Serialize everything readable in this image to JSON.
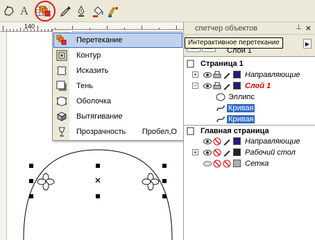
{
  "toolbar": {
    "tools": [
      {
        "name": "shape-tool",
        "icon": "shape-icon"
      },
      {
        "name": "text-tool",
        "icon": "text-icon",
        "glyph": "A"
      },
      {
        "name": "table-tool",
        "icon": "table-icon"
      },
      {
        "name": "interactive-blend-tool",
        "icon": "blend-icon"
      },
      {
        "name": "eyedropper-tool",
        "icon": "eyedropper-icon"
      },
      {
        "name": "outline-tool",
        "icon": "pen-nib-icon"
      },
      {
        "name": "fill-tool",
        "icon": "paint-bucket-icon"
      },
      {
        "name": "interactive-fill-tool",
        "icon": "interactive-fill-icon"
      }
    ],
    "highlight_color": "#e11a1a"
  },
  "ruler": {
    "label": "140"
  },
  "menu": {
    "items": [
      {
        "label": "Перетекание",
        "icon": "blend-icon",
        "selected": true,
        "shortcut": ""
      },
      {
        "label": "Контур",
        "icon": "contour-icon",
        "selected": false,
        "shortcut": ""
      },
      {
        "label": "Исказить",
        "icon": "distort-icon",
        "selected": false,
        "shortcut": ""
      },
      {
        "label": "Тень",
        "icon": "shadow-icon",
        "selected": false,
        "shortcut": ""
      },
      {
        "label": "Оболочка",
        "icon": "envelope-icon",
        "selected": false,
        "shortcut": ""
      },
      {
        "label": "Вытягивание",
        "icon": "extrude-icon",
        "selected": false,
        "shortcut": ""
      },
      {
        "label": "Прозрачность",
        "icon": "transparency-icon",
        "selected": false,
        "shortcut": "Пробел,О"
      }
    ]
  },
  "tooltip": {
    "text": "Интерактивное перетекание"
  },
  "panel": {
    "title": "спетчер объектов",
    "subtitle": "Слой 1",
    "pin_glyph": "⊥",
    "close_glyph": "×",
    "arrow_glyph": "▶",
    "tree": [
      {
        "label": "Страница 1",
        "kind": "header"
      },
      {
        "label": "Направляющие",
        "kind": "layer",
        "expander": "+",
        "color": "#2a1a6e",
        "style": "italic"
      },
      {
        "label": "Слой 1",
        "kind": "layer",
        "expander": "−",
        "color": "#2a1a6e",
        "style": "red"
      },
      {
        "label": "Эллипс",
        "kind": "object",
        "icon": "ellipse-icon"
      },
      {
        "label": "Кривая",
        "kind": "object",
        "icon": "curve-icon",
        "selected": true
      },
      {
        "label": "Кривая",
        "kind": "object",
        "icon": "curve-icon",
        "selected": true
      },
      {
        "label": "Главная страница",
        "kind": "header"
      },
      {
        "label": "Направляющие",
        "kind": "layer",
        "expander": "",
        "color": "#2a1a6e",
        "style": "italic",
        "locked": true
      },
      {
        "label": "Рабочий стол",
        "kind": "layer",
        "expander": "+",
        "color": "#222222",
        "style": "italic",
        "locked": true
      },
      {
        "label": "Сетка",
        "kind": "layer",
        "expander": "",
        "color": "#b0b0b0",
        "style": "italic",
        "locked": true
      }
    ]
  }
}
